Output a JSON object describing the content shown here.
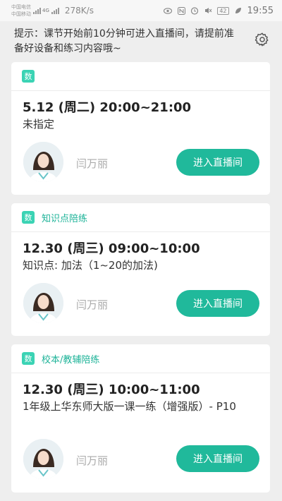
{
  "status_bar": {
    "carrier1": "中国电信",
    "carrier2": "中国移动",
    "network": "4G",
    "speed": "278K/s",
    "battery": "42",
    "time": "19:55"
  },
  "notice": "提示：课节开始前10分钟可进入直播间，请提前准备好设备和练习内容哦~",
  "icons": {
    "settings": "gear-icon"
  },
  "lessons": [
    {
      "badge": "数",
      "category": "",
      "time": "5.12 (周二) 20:00~21:00",
      "description": "未指定",
      "teacher": "闫万丽",
      "button": "进入直播间"
    },
    {
      "badge": "数",
      "category": "知识点陪练",
      "time": "12.30 (周三) 09:00~10:00",
      "description": "知识点: 加法（1~20的加法)",
      "teacher": "闫万丽",
      "button": "进入直播间"
    },
    {
      "badge": "数",
      "category": "校本/教辅陪练",
      "time": "12.30 (周三) 10:00~11:00",
      "description": "1年级上华东师大版一课一练（增强版）- P10",
      "teacher": "闫万丽",
      "button": "进入直播间"
    }
  ],
  "colors": {
    "accent": "#20b99b",
    "badge": "#3bd3b4",
    "category": "#1db398"
  }
}
